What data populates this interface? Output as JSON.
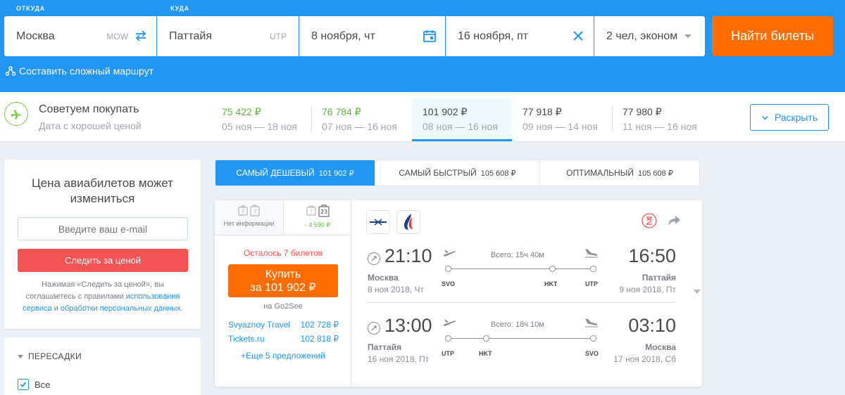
{
  "search": {
    "from_caption": "ОТКУДА",
    "to_caption": "КУДА",
    "from_city": "Москва",
    "from_code": "MOW",
    "to_city": "Паттайя",
    "to_code": "UTP",
    "depart_date": "8 ноября, чт",
    "return_date": "16 ноября, пт",
    "passengers": "2 чел, эконом",
    "find_label": "Найти билеты",
    "complex_route": "Составить сложный маршрут"
  },
  "suggest": {
    "title": "Советуем покупать",
    "subtitle": "Дата с хорошей ценой",
    "expand_label": "Раскрыть",
    "prices": [
      {
        "price": "75 422 ₽",
        "dates": "05 ноя — 18 ноя"
      },
      {
        "price": "76 784 ₽",
        "dates": "07 ноя — 16 ноя"
      },
      {
        "price": "101 902 ₽",
        "dates": "08 ноя — 16 ноя"
      },
      {
        "price": "77 918 ₽",
        "dates": "09 ноя — 14 ноя"
      },
      {
        "price": "77 980 ₽",
        "dates": "11 ноя — 16 ноя"
      }
    ]
  },
  "price_watch": {
    "title_line1": "Цена авиабилетов может",
    "title_line2": "измениться",
    "email_placeholder": "Введите ваш e-mail",
    "button": "Следить за ценой",
    "note_1": "Нажимая «Следить за ценой», вы",
    "note_2": "соглашаетесь с правилами ",
    "note_link1_a": "использования",
    "note_link1_b": "сервиса",
    "note_and": " и ",
    "note_link2": "обработки персональных данных",
    "note_end": "."
  },
  "filters": {
    "heading": "ПЕРЕСАДКИ",
    "all_label": "Все"
  },
  "sort": {
    "tabs": [
      {
        "label": "САМЫЙ ДЕШЕВЫЙ",
        "price": "101 902 ₽"
      },
      {
        "label": "САМЫЙ БЫСТРЫЙ",
        "price": "105 608 ₽"
      },
      {
        "label": "ОПТИМАЛЬНЫЙ",
        "price": "105 608 ₽"
      }
    ]
  },
  "ticket": {
    "bag_no_info": "Нет информации",
    "bag_with": "- 4 590 ₽",
    "bag_kg": "23",
    "bag_q": "?",
    "seats_left": "Осталось 7 билетов",
    "buy_line1": "Купить",
    "buy_line2": "за 101 902 ₽",
    "agency": "на Go2See",
    "offers": [
      {
        "name": "Svyaznoy Travel",
        "price": "102 728 ₽"
      },
      {
        "name": "Tickets.ru",
        "price": "102 818 ₽"
      }
    ],
    "more_offers": "+Еще 5 предложений",
    "segments": [
      {
        "dep_time": "21:10",
        "arr_time": "16:50",
        "duration": "Всего: 15ч 40м",
        "dep_city": "Москва",
        "arr_city": "Паттайя",
        "dep_date": "8 ноя 2018, Чт",
        "arr_date": "9 ноя 2018, Пт",
        "codes": [
          "SVO",
          "HKT",
          "UTP"
        ]
      },
      {
        "dep_time": "13:00",
        "arr_time": "03:10",
        "duration": "Всего: 18ч 10м",
        "dep_city": "Паттайя",
        "arr_city": "Москва",
        "dep_date": "16 ноя 2018, Пт",
        "arr_date": "17 ноя 2018, Сб",
        "codes": [
          "UTP",
          "HKT",
          "SVO"
        ]
      }
    ]
  },
  "colors": {
    "brand_blue": "#2196f3",
    "accent_orange": "#ff6d00",
    "alert_red": "#f25454",
    "green": "#61b73d"
  },
  "icons": {
    "swap": "swap-icon",
    "calendar": "calendar-icon",
    "clear": "close-icon",
    "plane": "plane-icon",
    "share": "share-icon"
  }
}
